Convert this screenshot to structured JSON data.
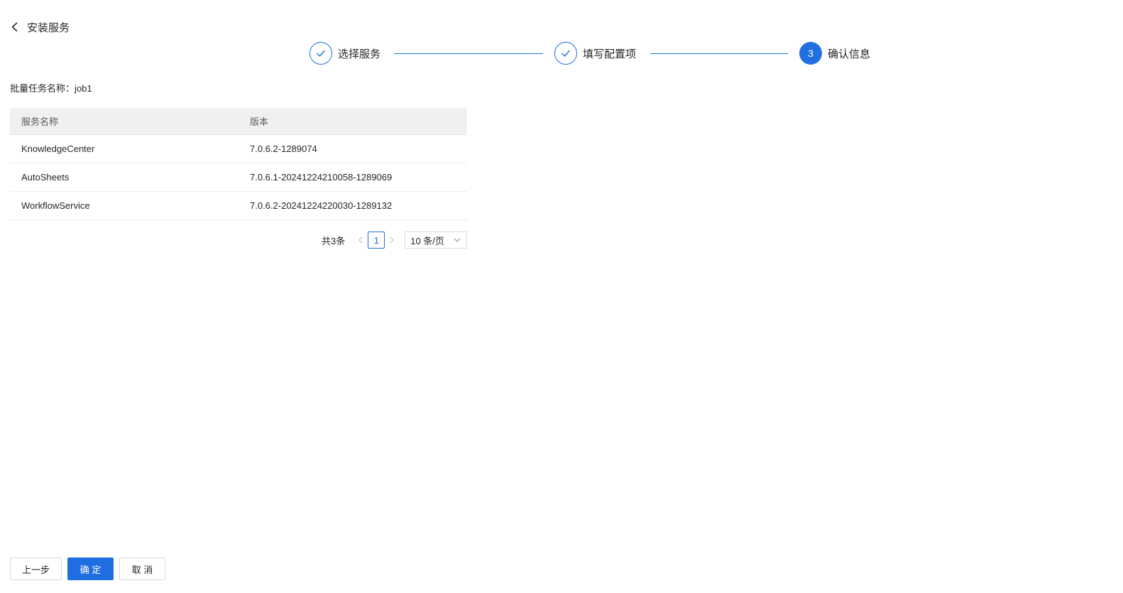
{
  "header": {
    "title": "安装服务",
    "back_icon": "chevron-left-icon"
  },
  "steps": [
    {
      "label": "选择服务",
      "status": "done"
    },
    {
      "label": "填写配置项",
      "status": "done"
    },
    {
      "label": "确认信息",
      "status": "active",
      "number": "3"
    }
  ],
  "batch": {
    "label": "批量任务名称：",
    "value": "job1"
  },
  "table": {
    "columns": [
      "服务名称",
      "版本"
    ],
    "rows": [
      {
        "name": "KnowledgeCenter",
        "version": "7.0.6.2-1289074"
      },
      {
        "name": "AutoSheets",
        "version": "7.0.6.1-20241224210058-1289069"
      },
      {
        "name": "WorkflowService",
        "version": "7.0.6.2-20241224220030-1289132"
      }
    ]
  },
  "pagination": {
    "total": "共3条",
    "current_page": "1",
    "page_size": "10 条/页"
  },
  "footer": {
    "prev_label": "上一步",
    "confirm_label": "确 定",
    "cancel_label": "取 消"
  },
  "colors": {
    "primary": "#1f6fe0",
    "header_bg": "#f0f0f0"
  }
}
